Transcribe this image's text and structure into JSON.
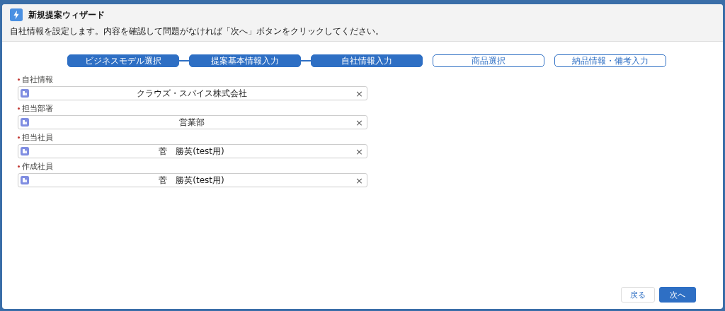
{
  "header": {
    "title": "新規提案ウィザード",
    "description": "自社情報を設定します。内容を確認して問題がなければ「次へ」ボタンをクリックしてください。"
  },
  "steps": [
    {
      "label": "ビジネスモデル選択",
      "completed": true
    },
    {
      "label": "提案基本情報入力",
      "completed": true
    },
    {
      "label": "自社情報入力",
      "completed": true
    },
    {
      "label": "商品選択",
      "completed": false
    },
    {
      "label": "納品情報・備考入力",
      "completed": false
    }
  ],
  "fields": [
    {
      "label": "自社情報",
      "required": true,
      "value": "クラウズ・スパイス株式会社",
      "clear": "×"
    },
    {
      "label": "担当部署",
      "required": true,
      "value": "営業部",
      "clear": "×"
    },
    {
      "label": "担当社員",
      "required": true,
      "value": "菅　勝英(test用)",
      "clear": "×"
    },
    {
      "label": "作成社員",
      "required": true,
      "value": "菅　勝英(test用)",
      "clear": "×"
    }
  ],
  "buttons": [
    {
      "label": "戻る",
      "kind": "neutral"
    },
    {
      "label": "次へ",
      "kind": "brand"
    }
  ]
}
